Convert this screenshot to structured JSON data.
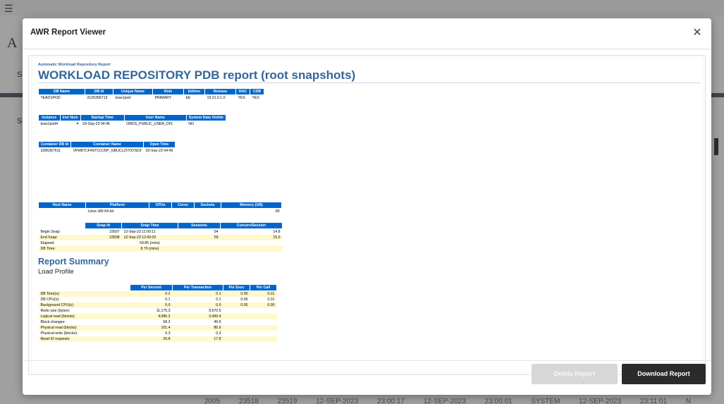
{
  "background": {
    "menu_icon": "hamburger-icon",
    "title": "A",
    "sub1": "S",
    "sub2": "Se",
    "row_text": "2005 23518 23519 12-SEP-2023 23:00:17 12-SEP-2023 23:00:01 SYSTEM 12-SEP-2023 23:11:01 N"
  },
  "modal": {
    "title": "AWR Report Viewer",
    "close_icon": "close-icon",
    "delete_label": "Delete Report",
    "download_label": "Download Report"
  },
  "report": {
    "small_title": "Automatic Workload Repository Report",
    "title": "WORKLOAD REPOSITORY PDB report (root snapshots)",
    "db_table": {
      "headers": [
        "DB Name",
        "DB Id",
        "Unique Name",
        "Role",
        "Edition",
        "Release",
        "RAC",
        "CDB"
      ],
      "row": [
        "TEAO1POD",
        "2125396713",
        "teao1pod",
        "PRIMARY",
        "EE",
        "19.21.0.1.0",
        "YES",
        "YES"
      ]
    },
    "instance_table": {
      "headers": [
        "Instance",
        "Inst Num",
        "Startup Time",
        "User Name",
        "System Data Visible"
      ],
      "row": [
        "teao1pod4",
        "4",
        "03-Sep-23 04:45",
        "ORDS_PUBLIC_USER_DIS",
        "NO"
      ]
    },
    "container_table": {
      "headers": [
        "Container DB Id",
        "Container Name",
        "Open Time"
      ],
      "row": [
        "3286367611",
        "VPHBTCF4STCOJSP_GBUCLZI7OVSD3",
        "03-Sep-23 04:49"
      ]
    },
    "host_table": {
      "headers": [
        "Host Name",
        "Platform",
        "CPUs",
        "Cores",
        "Sockets",
        "Memory (GB)"
      ],
      "row": [
        "",
        "Linux x86 64-bit",
        "",
        "",
        "",
        ".00"
      ]
    },
    "snap_table": {
      "headers": [
        "",
        "Snap Id",
        "Snap Time",
        "Sessions",
        "Cursors/Session"
      ],
      "rows": [
        [
          "Begin Snap:",
          "23507",
          "12-Sep-23 11:00:11",
          "54",
          "14.8"
        ],
        [
          "End Snap:",
          "23508",
          "12-Sep-23 12:00:02",
          "59",
          "15.0"
        ],
        [
          "Elapsed:",
          "",
          "59.85 (mins)",
          "",
          ""
        ],
        [
          "DB Time:",
          "",
          "8.70 (mins)",
          "",
          ""
        ]
      ]
    },
    "summary_title": "Report Summary",
    "load_profile_title": "Load Profile",
    "load_table": {
      "headers": [
        "",
        "Per Second",
        "Per Transaction",
        "Per Exec",
        "Per Call"
      ],
      "rows": [
        [
          "DB Time(s):",
          "0.2",
          "0.1",
          "0.00",
          "0.01"
        ],
        [
          "DB CPU(s):",
          "0.1",
          "0.1",
          "0.00",
          "0.01"
        ],
        [
          "Background CPU(s):",
          "0.0",
          "0.0",
          "0.00",
          "0.00"
        ],
        [
          "Redo size (bytes):",
          "11,175.3",
          "9,570.5",
          "",
          ""
        ],
        [
          "Logical read (blocks):",
          "4,086.2",
          "3,499.4",
          "",
          ""
        ],
        [
          "Block changes:",
          "58.3",
          "49.9",
          "",
          ""
        ],
        [
          "Physical read (blocks):",
          "101.4",
          "86.9",
          "",
          ""
        ],
        [
          "Physical write (blocks):",
          "0.3",
          "0.3",
          "",
          ""
        ],
        [
          "Read IO requests:",
          "20.8",
          "17.8",
          "",
          ""
        ]
      ]
    }
  }
}
